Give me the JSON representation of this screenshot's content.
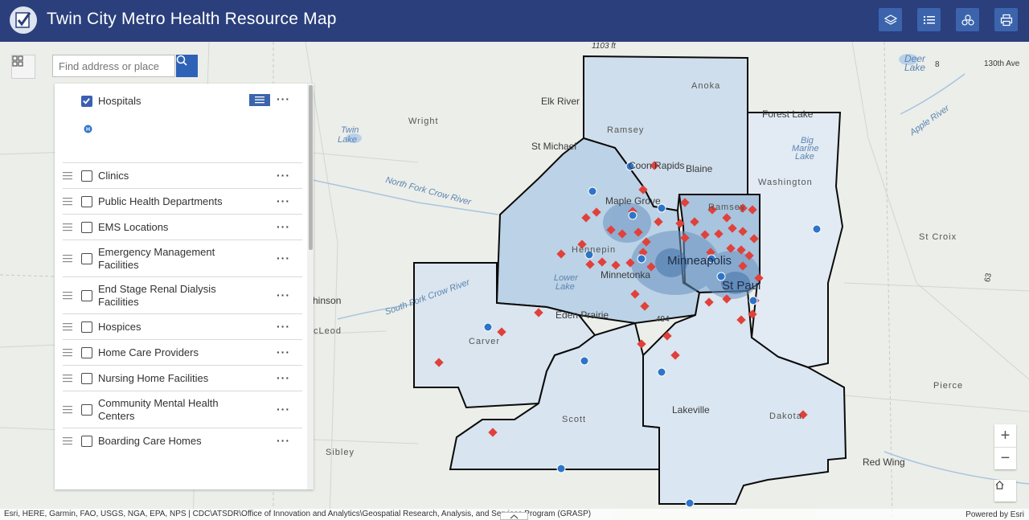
{
  "app": {
    "title": "Twin City Metro Health Resource Map"
  },
  "header_buttons": [
    {
      "name": "layers-icon"
    },
    {
      "name": "legend-list-icon"
    },
    {
      "name": "basemap-icon"
    },
    {
      "name": "print-icon"
    }
  ],
  "search": {
    "placeholder": "Find address or place"
  },
  "layers": {
    "hospitals": "Hospitals",
    "clinics": "Clinics",
    "public_health": "Public Health Departments",
    "ems": "EMS Locations",
    "emergency_mgmt_1": "Emergency Management",
    "emergency_mgmt_2": "Facilities",
    "renal_1": "End Stage Renal Dialysis",
    "renal_2": "Facilities",
    "hospices": "Hospices",
    "home_care": "Home Care Providers",
    "nursing_home": "Nursing Home Facilities",
    "mental_health_1": "Community Mental Health",
    "mental_health_2": "Centers",
    "boarding_care": "Boarding Care Homes"
  },
  "map_labels": {
    "elevation": "1103 ft",
    "anoka": "Anoka",
    "elk_river": "Elk River",
    "wright": "Wright",
    "twin_lake_1": "Twin",
    "twin_lake_2": "Lake",
    "ramsey": "Ramsey",
    "forest_lake": "Forest Lake",
    "big_marine_1": "Big",
    "big_marine_2": "Marine",
    "big_marine_3": "Lake",
    "washington": "Washington",
    "deer_lake_1": "Deer",
    "deer_lake_2": "Lake",
    "ave_130": "130th Ave",
    "apple_river": "Apple River",
    "st_michael": "St Michael",
    "coon_rapids": "Coon Rapids",
    "blaine": "Blaine",
    "north_fork": "North Fork Crow River",
    "maple_grove": "Maple Grove",
    "ramsey_co": "Ramsey",
    "hennepin": "Hennepin",
    "minneapolis": "Minneapolis",
    "st_paul": "St Paul",
    "minnetonka": "Minnetonka",
    "lower_lake_1": "Lower",
    "lower_lake_2": "Lake",
    "st_croix": "St Croix",
    "hutchinson": "chinson",
    "south_fork": "South Fork Crow River",
    "mcleod": "cLeod",
    "eden_prairie": "Eden Prairie",
    "carver": "Carver",
    "scott": "Scott",
    "lakeville": "Lakeville",
    "dakota": "Dakota",
    "pierce": "Pierce",
    "sibley": "Sibley",
    "red_wing": "Red Wing",
    "hwy_63": "63",
    "hwy_494": "494",
    "hwy_8": "8"
  },
  "attribution": {
    "text": "Esri, HERE, Garmin, FAO, USGS, NGA, EPA, NPS | CDC\\ATSDR\\Office of Innovation and Analytics\\Geospatial Research, Analysis, and Services Program (GRASP)",
    "powered": "Powered by Esri"
  },
  "controls": {
    "zoom_in": "+",
    "zoom_out": "−"
  },
  "colors": {
    "header": "#2a3f7c",
    "accent": "#3c64ad",
    "marker_red": "#e0413b",
    "hospital_blue": "#2e74c9"
  }
}
